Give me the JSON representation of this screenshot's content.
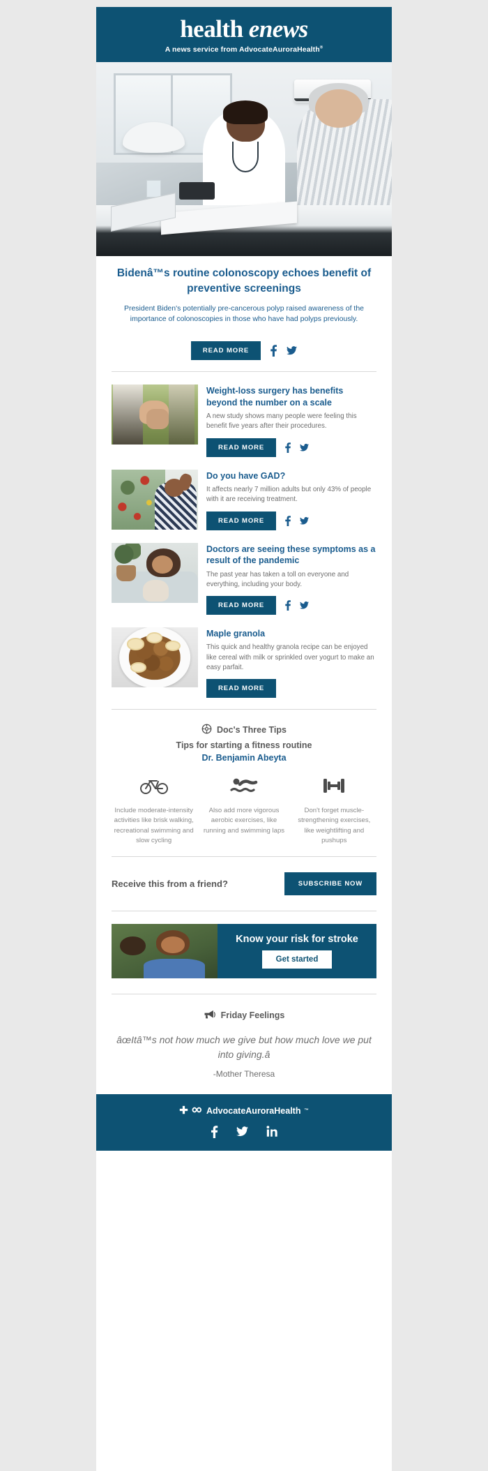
{
  "masthead": {
    "logo_word1": "health ",
    "logo_word2": "enews",
    "tagline_prefix": "A news service from ",
    "tagline_brand": "AdvocateAuroraHealth",
    "tagline_tm": "®"
  },
  "lead": {
    "title": "Bidenâ™s routine colonoscopy echoes benefit of preventive screenings",
    "description": "President Biden's potentially pre-cancerous polyp raised awareness of the importance of colonoscopies in those who have had polyps previously.",
    "read_more": "READ MORE",
    "facebook_icon": "facebook-icon",
    "twitter_icon": "twitter-icon"
  },
  "articles": [
    {
      "title": "Weight-loss surgery has benefits beyond the number on a scale",
      "description": "A new study shows many people were feeling this benefit five years after their procedures.",
      "read_more": "READ MORE",
      "thumb": "hands-holding-image",
      "has_social": true
    },
    {
      "title": "Do you have GAD?",
      "description": "It affects nearly 7 million adults but only 43% of people with it are receiving treatment.",
      "read_more": "READ MORE",
      "thumb": "woman-stressed-image",
      "has_social": true
    },
    {
      "title": "Doctors are seeing these symptoms as a result of the pandemic",
      "description": "The past year has taken a toll on everyone and everything, including your body.",
      "read_more": "READ MORE",
      "thumb": "child-with-teddy-image",
      "has_social": true
    },
    {
      "title": "Maple granola",
      "description": "This quick and healthy granola recipe can be enjoyed like cereal with milk or sprinkled over yogurt to make an easy parfait.",
      "read_more": "READ MORE",
      "thumb": "granola-bowl-image",
      "has_social": false
    }
  ],
  "tips": {
    "section_label": "Doc's Three Tips",
    "section_icon": "stethoscope-icon",
    "subtitle": "Tips for starting a fitness routine",
    "doctor": "Dr. Benjamin Abeyta",
    "items": [
      {
        "icon": "bicycle-icon",
        "text": "Include moderate-intensity activities like brisk walking, recreational swimming and slow cycling"
      },
      {
        "icon": "swimmer-icon",
        "text": "Also add more vigorous aerobic exercises, like running and swimming laps"
      },
      {
        "icon": "dumbbell-icon",
        "text": "Don't forget muscle-strengthening exercises, like weightlifting and pushups"
      }
    ]
  },
  "subscribe": {
    "prompt": "Receive this from a friend?",
    "button": "SUBSCRIBE NOW"
  },
  "promo": {
    "title": "Know your risk for stroke",
    "button": "Get started",
    "image": "smiling-friends-outdoors-image"
  },
  "feelings": {
    "section_label": "Friday Feelings",
    "section_icon": "megaphone-icon",
    "quote": "âœItâ™s not how much we give but how much love we put into giving.â",
    "author": "-Mother Theresa"
  },
  "footer": {
    "brand": "AdvocateAuroraHealth",
    "brand_tm": "™",
    "cross_icon": "cross-icon",
    "infinity_icon": "infinity-icon",
    "social": [
      {
        "icon": "facebook-icon",
        "glyph": "f"
      },
      {
        "icon": "twitter-icon",
        "glyph": "twitter"
      },
      {
        "icon": "linkedin-icon",
        "glyph": "in"
      }
    ]
  },
  "colors": {
    "brand_blue": "#0d5273",
    "link_blue": "#1a5c8e",
    "body_gray": "#6e6e6e",
    "page_bg": "#e9e9e9"
  }
}
